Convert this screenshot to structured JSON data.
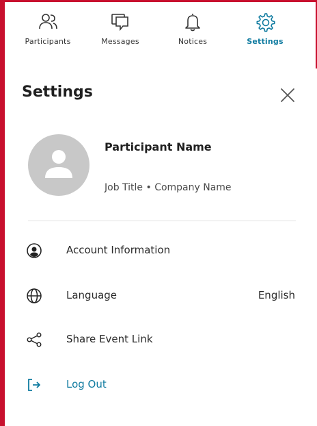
{
  "tabs": [
    {
      "label": "Participants",
      "icon": "participants-icon"
    },
    {
      "label": "Messages",
      "icon": "messages-icon"
    },
    {
      "label": "Notices",
      "icon": "bell-icon"
    },
    {
      "label": "Settings",
      "icon": "gear-icon",
      "active": true
    }
  ],
  "header": {
    "title": "Settings",
    "close_icon": "close-icon"
  },
  "profile": {
    "name": "Participant Name",
    "job_line": "Job Title • Company Name",
    "avatar_icon": "user-silhouette-icon"
  },
  "menu": [
    {
      "label": "Account Information",
      "icon": "account-circle-icon"
    },
    {
      "label": "Language",
      "icon": "globe-icon",
      "value": "English"
    },
    {
      "label": "Share Event Link",
      "icon": "share-icon"
    },
    {
      "label": "Log Out",
      "icon": "logout-icon"
    }
  ],
  "colors": {
    "accent": "#0f7ba0",
    "frame": "#c8102e",
    "text": "#1f1f1f",
    "avatar_bg": "#c8c8c8"
  }
}
